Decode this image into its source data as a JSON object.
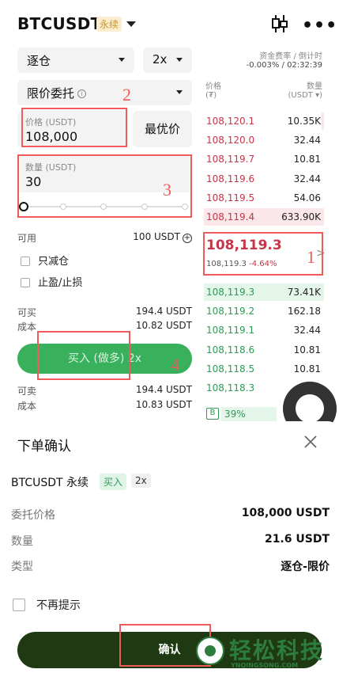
{
  "header": {
    "pair": "BTCUSDT",
    "badge": "永续"
  },
  "form": {
    "margin_mode": "逐仓",
    "leverage": "2x",
    "order_type": "限价委托",
    "price_label": "价格 (USDT)",
    "price_value": "108,000",
    "best_price_label": "最优价",
    "qty_label": "数量 (USDT)",
    "qty_value": "30",
    "available_label": "可用",
    "available_value": "100 USDT",
    "reduce_only_label": "只减仓",
    "tpsl_label": "止盈/止损",
    "can_buy_label": "可买",
    "can_buy_value": "194.4 USDT",
    "cost_label": "成本",
    "cost_buy_value": "10.82 USDT",
    "buy_label": "买入 (做多) 2x",
    "can_sell_label": "可卖",
    "can_sell_value": "194.4 USDT",
    "cost_sell_value": "10.83 USDT"
  },
  "orderbook": {
    "funding_label": "资金费率 / 倒计时",
    "funding_value": "-0.003% / 02:32:39",
    "price_header": "价格",
    "price_unit": "(₮)",
    "qty_header": "数量",
    "qty_unit": "(USDT ▾)",
    "asks": [
      {
        "price": "108,120.1",
        "size": "10.35K",
        "depth": 0.02
      },
      {
        "price": "108,120.0",
        "size": "32.44",
        "depth": 0.0
      },
      {
        "price": "108,119.7",
        "size": "10.81",
        "depth": 0.0
      },
      {
        "price": "108,119.6",
        "size": "32.44",
        "depth": 0.0
      },
      {
        "price": "108,119.5",
        "size": "54.06",
        "depth": 0.0
      },
      {
        "price": "108,119.4",
        "size": "633.90K",
        "depth": 1.0
      }
    ],
    "mid_price": "108,119.3",
    "mid_sub_price": "108,119.3",
    "mid_change": "-4.64%",
    "bids": [
      {
        "price": "108,119.3",
        "size": "73.41K",
        "depth": 1.0
      },
      {
        "price": "108,119.2",
        "size": "162.18",
        "depth": 0.0
      },
      {
        "price": "108,119.1",
        "size": "32.44",
        "depth": 0.0
      },
      {
        "price": "108,118.6",
        "size": "10.81",
        "depth": 0.0
      },
      {
        "price": "108,118.5",
        "size": "10.81",
        "depth": 0.0
      },
      {
        "price": "108,118.3",
        "size": "",
        "depth": 0.0
      }
    ],
    "ratio_label": "B",
    "ratio_pct": "39%"
  },
  "sheet": {
    "title": "下单确认",
    "pair": "BTCUSDT 永续",
    "side_tag": "买入",
    "lev_tag": "2x",
    "price_label": "委托价格",
    "price_value": "108,000 USDT",
    "qty_label": "数量",
    "qty_value": "21.6 USDT",
    "type_label": "类型",
    "type_value": "逐仓-限价",
    "no_remind_label": "不再提示",
    "confirm_label": "确认"
  },
  "annotations": {
    "n1": "1",
    "n2": "2",
    "n3": "3",
    "n4": "4"
  },
  "watermark": {
    "text": "轻松科技",
    "url": "YNQINGSONG.COM"
  },
  "colors": {
    "buy_green": "#39b05b",
    "ask_red": "#c43649",
    "bid_green": "#2f9a55",
    "confirm_dark": "#1f3a12",
    "annotation_red": "#ef5a5a"
  }
}
